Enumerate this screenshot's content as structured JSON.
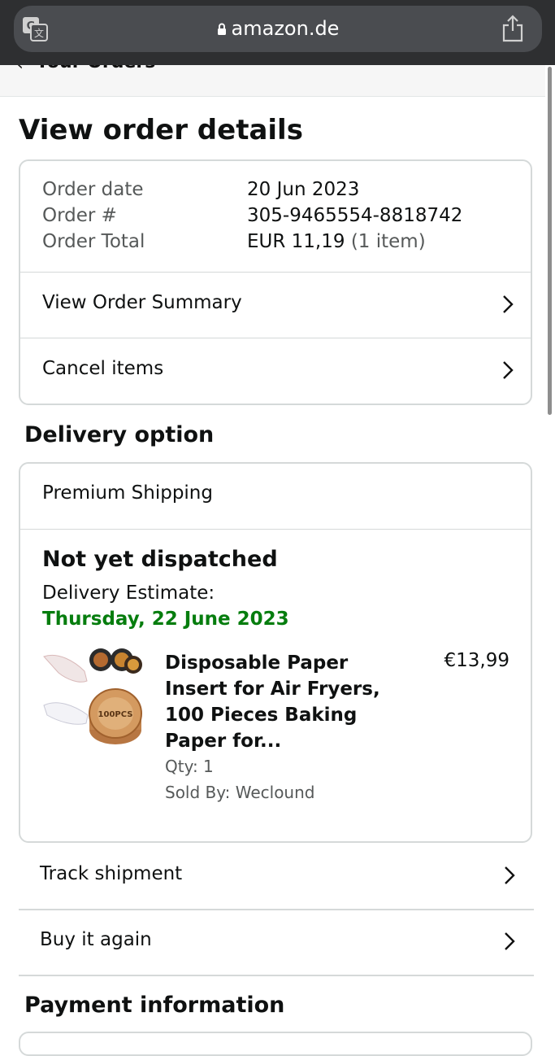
{
  "browser": {
    "url": "amazon.de"
  },
  "nav": {
    "back_label": "Your Orders"
  },
  "page": {
    "title": "View order details"
  },
  "order": {
    "date_label": "Order date",
    "date_value": "20 Jun 2023",
    "number_label": "Order #",
    "number_value": "305-9465554-8818742",
    "total_label": "Order Total",
    "total_value": "EUR 11,19",
    "total_items": "(1 item)",
    "links": [
      {
        "label": "View Order Summary"
      },
      {
        "label": "Cancel items"
      }
    ]
  },
  "delivery": {
    "section_title": "Delivery option",
    "shipping_method": "Premium Shipping",
    "status": "Not yet dispatched",
    "estimate_label": "Delivery Estimate:",
    "estimate_date": "Thursday, 22 June 2023",
    "product": {
      "title": "Disposable Paper Insert for Air Fryers, 100 Pieces Baking Paper for...",
      "price": "€13,99",
      "qty": "Qty: 1",
      "sold_by": "Sold By: Weclound",
      "image_text": "100PCS"
    },
    "actions": [
      {
        "label": "Track shipment"
      },
      {
        "label": "Buy it again"
      }
    ]
  },
  "payment": {
    "section_title": "Payment information"
  },
  "colors": {
    "green": "#067d0e",
    "border": "#d5d9d9",
    "browser_bar": "#2e2f31"
  }
}
